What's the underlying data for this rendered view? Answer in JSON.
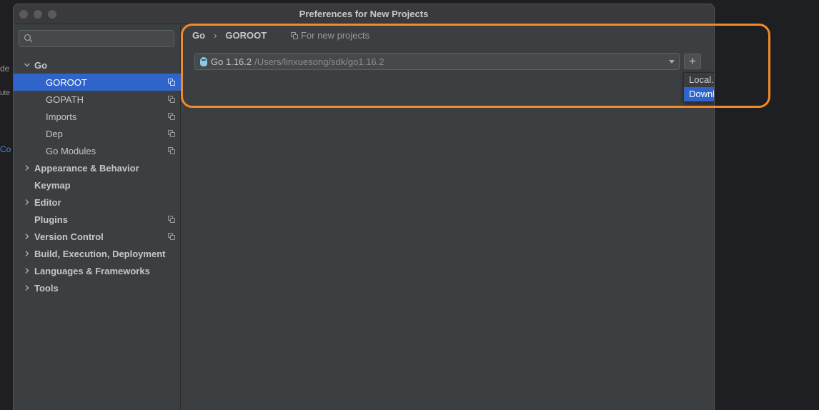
{
  "window": {
    "title": "Preferences for New Projects"
  },
  "background": {
    "frag1": "de",
    "frag2": "ute",
    "frag3": "Co"
  },
  "search": {
    "placeholder": ""
  },
  "sidebar": {
    "items": [
      {
        "label": "Go",
        "bold": true,
        "expanded": true,
        "level": 0,
        "settings_icon": false
      },
      {
        "label": "GOROOT",
        "bold": false,
        "level": 1,
        "selected": true,
        "settings_icon": true
      },
      {
        "label": "GOPATH",
        "bold": false,
        "level": 1,
        "settings_icon": true
      },
      {
        "label": "Imports",
        "bold": false,
        "level": 1,
        "settings_icon": true
      },
      {
        "label": "Dep",
        "bold": false,
        "level": 1,
        "settings_icon": true
      },
      {
        "label": "Go Modules",
        "bold": false,
        "level": 1,
        "settings_icon": true
      },
      {
        "label": "Appearance & Behavior",
        "bold": true,
        "expandable": true,
        "level": 0,
        "settings_icon": false
      },
      {
        "label": "Keymap",
        "bold": true,
        "level": 0,
        "settings_icon": false
      },
      {
        "label": "Editor",
        "bold": true,
        "expandable": true,
        "level": 0,
        "settings_icon": false
      },
      {
        "label": "Plugins",
        "bold": true,
        "level": 0,
        "settings_icon": true
      },
      {
        "label": "Version Control",
        "bold": true,
        "expandable": true,
        "level": 0,
        "settings_icon": true
      },
      {
        "label": "Build, Execution, Deployment",
        "bold": true,
        "expandable": true,
        "level": 0,
        "settings_icon": false
      },
      {
        "label": "Languages & Frameworks",
        "bold": true,
        "expandable": true,
        "level": 0,
        "settings_icon": false
      },
      {
        "label": "Tools",
        "bold": true,
        "expandable": true,
        "level": 0,
        "settings_icon": false
      }
    ]
  },
  "breadcrumb": {
    "parent": "Go",
    "separator": "›",
    "current": "GOROOT"
  },
  "scope_note": "For new projects",
  "sdk": {
    "version": "Go 1.16.2",
    "path": "/Users/linxuesong/sdk/go1.16.2"
  },
  "add_button": {
    "label": "+"
  },
  "popup": {
    "items": [
      "Local...",
      "Download..."
    ],
    "selected_index": 1
  },
  "colors": {
    "accent": "#2f65ca",
    "highlight": "#f28a2a",
    "background": "#3c3f41"
  }
}
